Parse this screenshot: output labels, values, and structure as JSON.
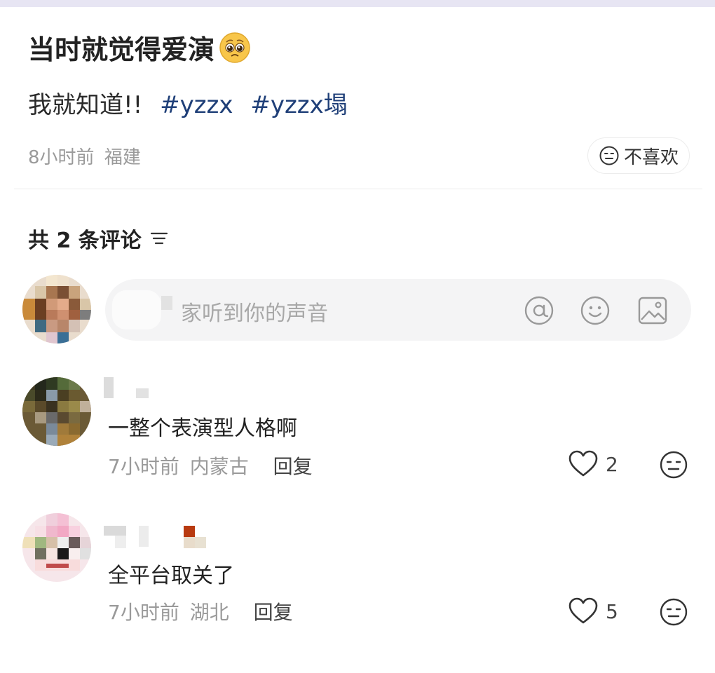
{
  "post": {
    "title": "当时就觉得爱演",
    "title_emoji": "pleading-face-icon",
    "body_text": "我就知道!!",
    "hashtags": [
      "#yzzx",
      "#yzzx塌"
    ],
    "time": "8小时前",
    "location": "福建",
    "dislike_label": "不喜欢"
  },
  "comments_header": {
    "label": "共 2 条评论"
  },
  "comment_input": {
    "placeholder": "家听到你的声音",
    "icons": [
      "at-icon",
      "emoji-icon",
      "image-icon"
    ]
  },
  "comments": [
    {
      "text": "一整个表演型人格啊",
      "time": "7小时前",
      "location": "内蒙古",
      "reply_label": "回复",
      "likes": "2"
    },
    {
      "text": "全平台取关了",
      "time": "7小时前",
      "location": "湖北",
      "reply_label": "回复",
      "likes": "5"
    }
  ],
  "colors": {
    "hashtag": "#1f3f78",
    "meta_gray": "#9a9a9a",
    "top_bar": "#e7e5f3"
  }
}
